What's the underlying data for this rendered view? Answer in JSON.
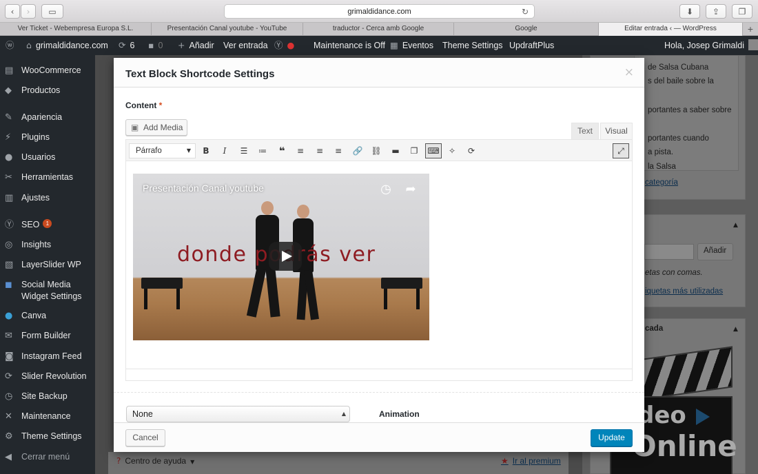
{
  "browser": {
    "url": "grimaldidance.com",
    "tabs": [
      {
        "label": "Ver Ticket - Webempresa Europa S.L."
      },
      {
        "label": "Presentación Canal youtube - YouTube"
      },
      {
        "label": "traductor - Cerca amb Google"
      },
      {
        "label": "Google"
      },
      {
        "label": "Editar entrada ‹ — WordPress"
      }
    ],
    "new_tab": "+"
  },
  "adminbar": {
    "site": "grimaldidance.com",
    "updates": "6",
    "comments": "0",
    "new": "Añadir",
    "view": "Ver entrada",
    "maintenance": "Maintenance is Off",
    "events": "Eventos",
    "theme_settings": "Theme Settings",
    "updraft": "UpdraftPlus",
    "greeting": "Hola, Josep Grimaldi"
  },
  "sidebar": {
    "items": [
      {
        "label": "WooCommerce",
        "icon": "woo-icon"
      },
      {
        "label": "Productos",
        "icon": "box-icon"
      },
      {
        "label": "Apariencia",
        "icon": "brush-icon"
      },
      {
        "label": "Plugins",
        "icon": "plug-icon"
      },
      {
        "label": "Usuarios",
        "icon": "user-icon"
      },
      {
        "label": "Herramientas",
        "icon": "wrench-icon"
      },
      {
        "label": "Ajustes",
        "icon": "sliders-icon"
      },
      {
        "label": "SEO",
        "icon": "yoast-icon",
        "badge": "1"
      },
      {
        "label": "Insights",
        "icon": "insights-icon"
      },
      {
        "label": "LayerSlider WP",
        "icon": "layers-icon"
      },
      {
        "label": "Social Media Widget Settings",
        "icon": "social-icon"
      },
      {
        "label": "Canva",
        "icon": "canva-icon"
      },
      {
        "label": "Form Builder",
        "icon": "form-icon"
      },
      {
        "label": "Instagram Feed",
        "icon": "instagram-icon"
      },
      {
        "label": "Slider Revolution",
        "icon": "refresh-icon"
      },
      {
        "label": "Site Backup",
        "icon": "clock-icon"
      },
      {
        "label": "Maintenance",
        "icon": "tools-icon"
      },
      {
        "label": "Theme Settings",
        "icon": "gear-icon"
      },
      {
        "label": "Cerrar menú",
        "icon": "collapse-icon"
      }
    ]
  },
  "background": {
    "right_lines": [
      "de Salsa Cubana",
      "s del baile sobre la",
      "portantes a saber sobre",
      "portantes cuando",
      "a pista.",
      "la Salsa"
    ],
    "category_link": "categoría",
    "tag_add": "Añadir",
    "tag_hint": "etas con comas.",
    "tag_link": "iquetas más utilizadas",
    "featured": "cada",
    "help": "Centro de ayuda",
    "premium": "Ir al premium",
    "logo_t1": "deo",
    "logo_t2": "Online"
  },
  "modal": {
    "title": "Text Block Shortcode Settings",
    "close": "×",
    "content_label": "Content",
    "required": "*",
    "add_media": "Add Media",
    "tab_text": "Text",
    "tab_visual": "Visual",
    "format_value": "Párrafo",
    "video": {
      "title": "Presentación Canal youtube",
      "overlay_text": "donde podrás ver"
    },
    "select_value": "None",
    "animation_label": "Animation",
    "cancel": "Cancel",
    "update": "Update"
  }
}
